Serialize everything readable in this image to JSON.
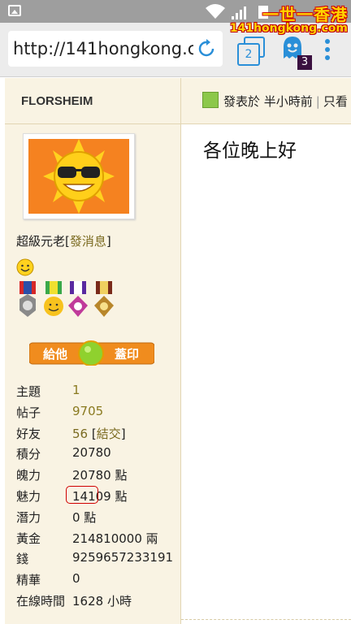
{
  "browser": {
    "url": "http://141hongkong.com",
    "tab_count": "2",
    "ghostery_count": "3"
  },
  "watermark": {
    "title": "一世一香港",
    "site": "141hongkong.com"
  },
  "sidebar": {
    "username": "FLORSHEIM",
    "rank": "超級元老",
    "send_message": "發消息",
    "stats": [
      {
        "key": "主題",
        "value": "1"
      },
      {
        "key": "帖子",
        "value": "9705"
      },
      {
        "key": "好友",
        "value": "56",
        "link": "結交"
      },
      {
        "key": "積分",
        "value": "20780"
      },
      {
        "key": "魄力",
        "value": "20780 點"
      },
      {
        "key": "魅力",
        "value": "14109 點"
      },
      {
        "key": "潛力",
        "value": "0 點"
      },
      {
        "key": "黃金",
        "value": "214810000 兩"
      },
      {
        "key": "錢",
        "value": "9259657233191"
      },
      {
        "key": "精華",
        "value": "0"
      },
      {
        "key": "在線時間",
        "value": "1628 小時"
      }
    ],
    "stamp_button": {
      "left": "給他",
      "right": "蓋印"
    }
  },
  "post": {
    "posted_at": "發表於 半小時前",
    "only_view": "只看",
    "body": "各位晚上好"
  },
  "colors": {
    "sidebar_bg": "#f9f3e3",
    "link": "#7a6a20",
    "accent_blue": "#2a8fd8",
    "annotation_red": "#d00000"
  }
}
